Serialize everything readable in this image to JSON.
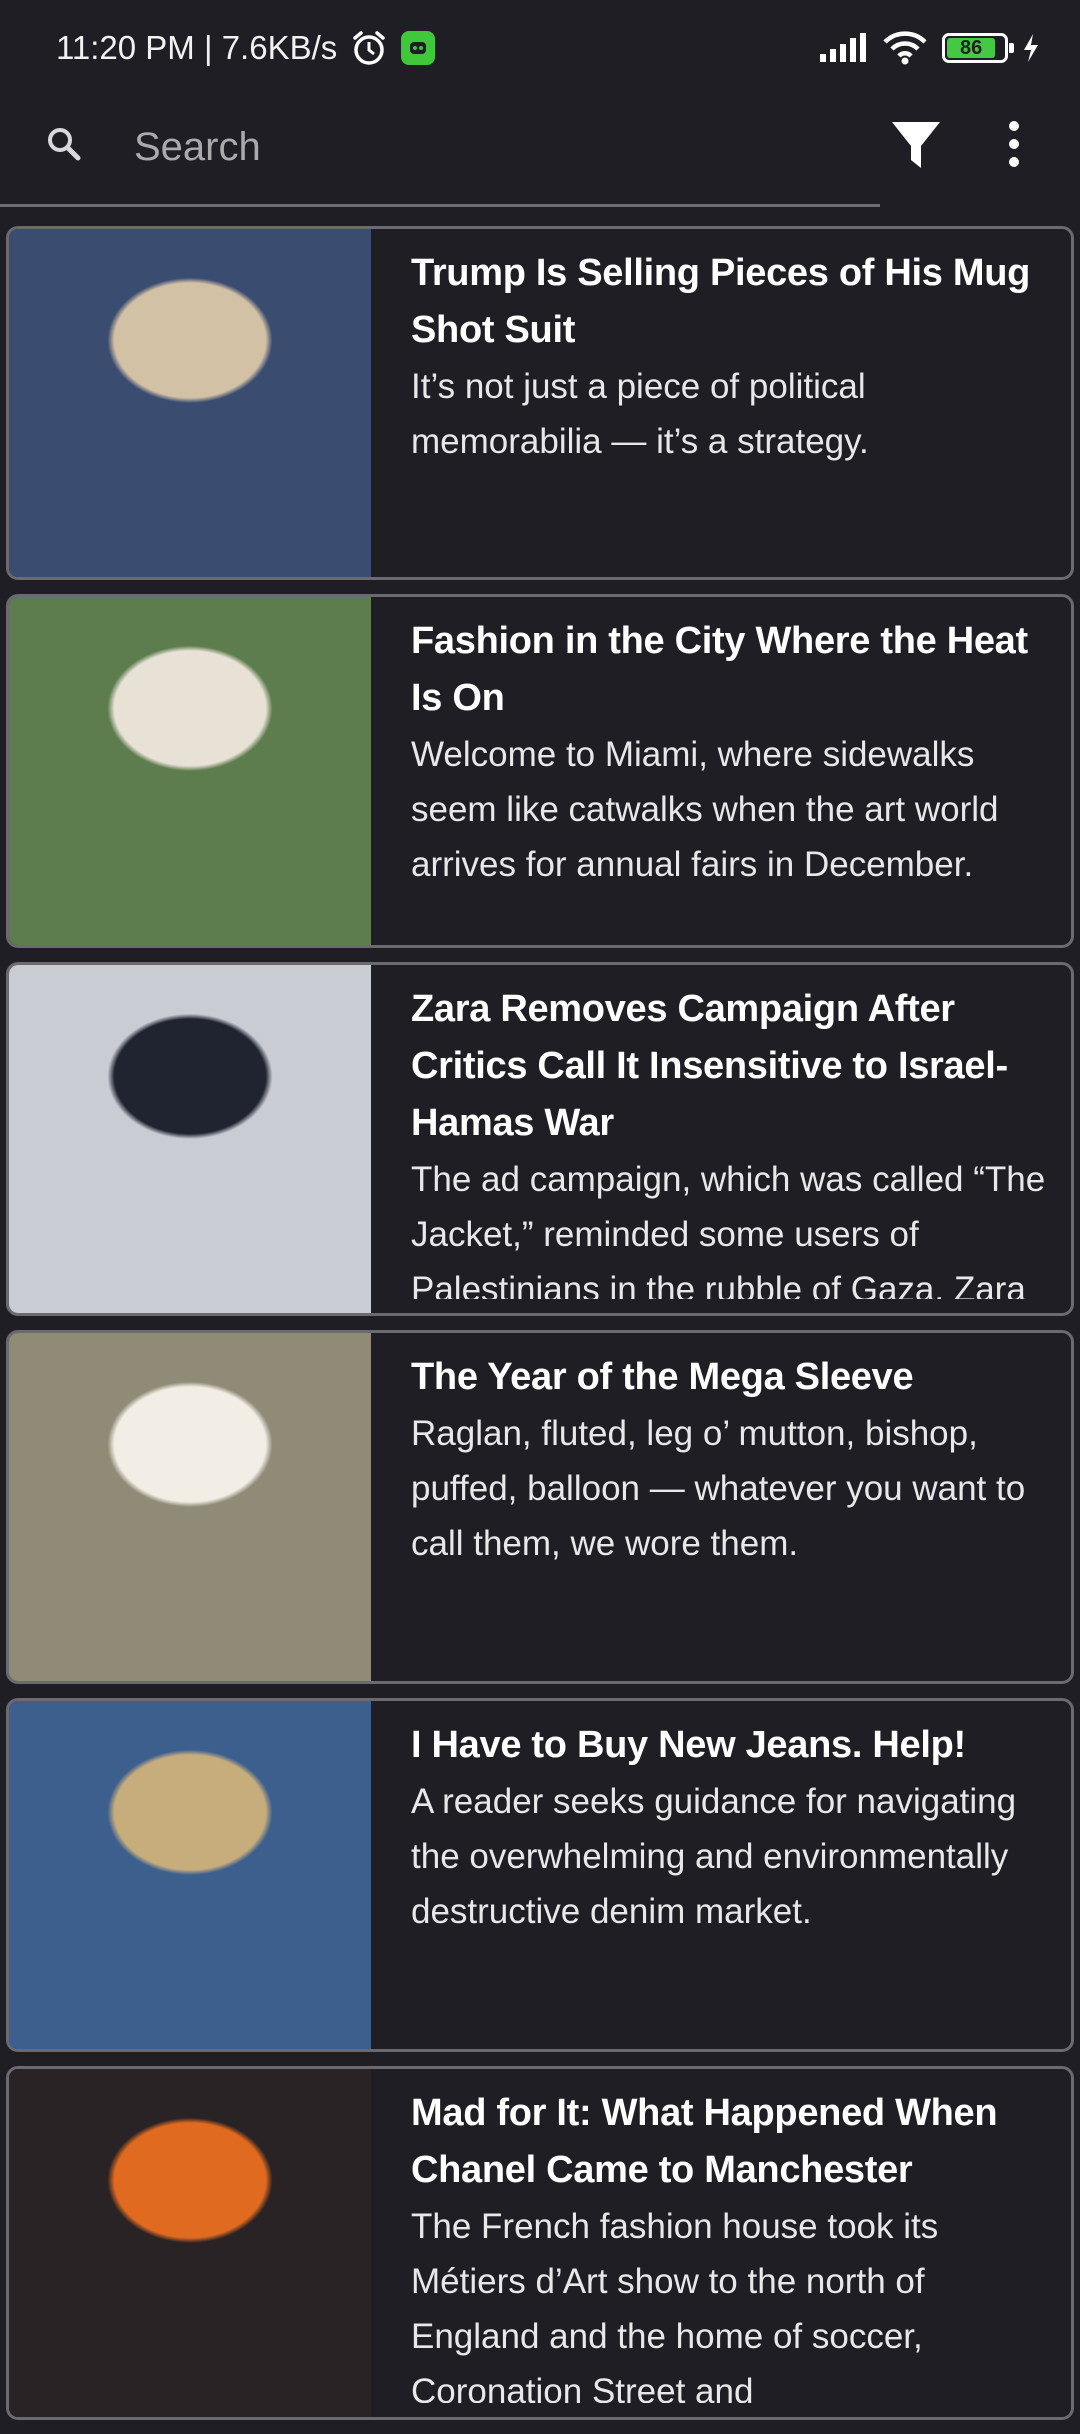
{
  "status_bar": {
    "time_speed": "11:20 PM | 7.6KB/s",
    "battery_level": "86",
    "icons": [
      "alarm-icon",
      "app-notification-icon",
      "signal-icon",
      "wifi-icon",
      "battery-icon",
      "charging-icon"
    ]
  },
  "toolbar": {
    "search_placeholder": "Search",
    "icons": [
      "search-icon",
      "filter-icon",
      "more-options-icon"
    ]
  },
  "articles": [
    {
      "title": "Trump Is Selling Pieces of His Mug Shot Suit",
      "summary": "It’s not just a piece of political memorabilia — it’s a strategy.",
      "thumb_colors": [
        "#3a4c70",
        "#d3c1a5"
      ]
    },
    {
      "title": "Fashion in the City Where the Heat Is On",
      "summary": "Welcome to Miami, where sidewalks seem like catwalks when the art world arrives for annual fairs in December.",
      "thumb_colors": [
        "#5e7d4e",
        "#e8e2d6"
      ]
    },
    {
      "title": "Zara Removes Campaign After Critics Call It Insensitive to Israel-Hamas War",
      "summary": "The ad campaign, which was called “The Jacket,” reminded some users of Palestinians in the rubble of Gaza. Zara said it shot the campaign before the war",
      "thumb_colors": [
        "#c9ccd3",
        "#1f2430"
      ]
    },
    {
      "title": "The Year of the Mega Sleeve",
      "summary": "Raglan, fluted, leg o’ mutton, bishop, puffed, balloon — whatever you want to call them, we wore them.",
      "thumb_colors": [
        "#8f8b76",
        "#f2eee6"
      ]
    },
    {
      "title": "I Have to Buy New Jeans. Help!",
      "summary": "A reader seeks guidance for navigating the overwhelming and environmentally destructive denim market.",
      "thumb_colors": [
        "#3d5f8e",
        "#c7ad7c"
      ]
    },
    {
      "title": "Mad for It: What Happened When Chanel Came to Manchester",
      "summary": "The French fashion house took its Métiers d’Art show to the north of England and the home of soccer, Coronation Street and",
      "thumb_colors": [
        "#2a2325",
        "#e06a1f"
      ]
    }
  ]
}
